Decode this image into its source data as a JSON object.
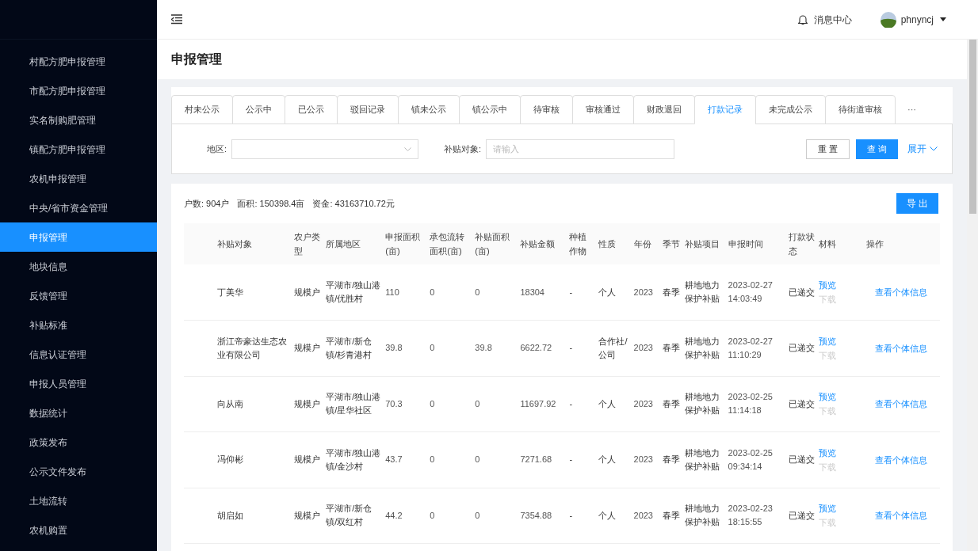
{
  "sidebar": {
    "items": [
      {
        "label": "村配方肥申报管理",
        "selected": false
      },
      {
        "label": "市配方肥申报管理",
        "selected": false
      },
      {
        "label": "实名制购肥管理",
        "selected": false
      },
      {
        "label": "镇配方肥申报管理",
        "selected": false
      },
      {
        "label": "农机申报管理",
        "selected": false
      },
      {
        "label": "中央/省市资金管理",
        "selected": false
      },
      {
        "label": "申报管理",
        "selected": true
      },
      {
        "label": "地块信息",
        "selected": false
      },
      {
        "label": "反馈管理",
        "selected": false
      },
      {
        "label": "补贴标准",
        "selected": false
      },
      {
        "label": "信息认证管理",
        "selected": false
      },
      {
        "label": "申报人员管理",
        "selected": false
      },
      {
        "label": "数据统计",
        "selected": false
      },
      {
        "label": "政策发布",
        "selected": false
      },
      {
        "label": "公示文件发布",
        "selected": false
      },
      {
        "label": "土地流转",
        "selected": false
      },
      {
        "label": "农机购置",
        "selected": false
      }
    ]
  },
  "header": {
    "messages": "消息中心",
    "user": "phnyncj"
  },
  "page_title": "申报管理",
  "tabs": [
    {
      "label": "村未公示",
      "selected": false
    },
    {
      "label": "公示中",
      "selected": false
    },
    {
      "label": "已公示",
      "selected": false
    },
    {
      "label": "驳回记录",
      "selected": false
    },
    {
      "label": "镇未公示",
      "selected": false
    },
    {
      "label": "镇公示中",
      "selected": false
    },
    {
      "label": "待审核",
      "selected": false
    },
    {
      "label": "审核通过",
      "selected": false
    },
    {
      "label": "财政退回",
      "selected": false
    },
    {
      "label": "打款记录",
      "selected": true
    },
    {
      "label": "未完成公示",
      "selected": false
    },
    {
      "label": "待街道审核",
      "selected": false
    }
  ],
  "tabs_more": "···",
  "filters": {
    "region_label": "地区:",
    "target_label": "补贴对象:",
    "target_placeholder": "请输入",
    "reset": "重 置",
    "search": "查 询",
    "expand": "展开"
  },
  "summary": {
    "households": "户数: 904户",
    "area": "面积: 150398.4亩",
    "funds": "资金: 43163710.72元",
    "export": "导 出"
  },
  "table": {
    "columns": [
      "补贴对象",
      "农户类型",
      "所属地区",
      "申报面积(亩)",
      "承包流转面积(亩)",
      "补贴面积(亩)",
      "补贴金额",
      "种植作物",
      "性质",
      "年份",
      "季节",
      "补贴项目",
      "申报时间",
      "打款状态",
      "材料",
      "操作"
    ],
    "rows": [
      {
        "cells": [
          "丁美华",
          "规模户",
          "平湖市/独山港镇/优胜村",
          "110",
          "0",
          "0",
          "18304",
          "-",
          "个人",
          "2023",
          "春季",
          "耕地地力保护补贴",
          "2023-02-27 14:03:49",
          "已递交"
        ],
        "preview": "预览",
        "download": {
          "label": "下载",
          "disabled": true
        },
        "action": "查看个体信息"
      },
      {
        "cells": [
          "浙江帝豪达生态农业有限公司",
          "规模户",
          "平湖市/新仓镇/杉青港村",
          "39.8",
          "0",
          "39.8",
          "6622.72",
          "-",
          "合作社/公司",
          "2023",
          "春季",
          "耕地地力保护补贴",
          "2023-02-27 11:10:29",
          "已递交"
        ],
        "preview": "预览",
        "download": {
          "label": "下载",
          "disabled": true
        },
        "action": "查看个体信息"
      },
      {
        "cells": [
          "向从南",
          "规模户",
          "平湖市/独山港镇/星华社区",
          "70.3",
          "0",
          "0",
          "11697.92",
          "-",
          "个人",
          "2023",
          "春季",
          "耕地地力保护补贴",
          "2023-02-25 11:14:18",
          "已递交"
        ],
        "preview": "预览",
        "download": {
          "label": "下载",
          "disabled": true
        },
        "action": "查看个体信息"
      },
      {
        "cells": [
          "冯仰彬",
          "规模户",
          "平湖市/独山港镇/金沙村",
          "43.7",
          "0",
          "0",
          "7271.68",
          "-",
          "个人",
          "2023",
          "春季",
          "耕地地力保护补贴",
          "2023-02-25 09:34:14",
          "已递交"
        ],
        "preview": "预览",
        "download": {
          "label": "下载",
          "disabled": true
        },
        "action": "查看个体信息"
      },
      {
        "cells": [
          "胡启如",
          "规模户",
          "平湖市/新仓镇/双红村",
          "44.2",
          "0",
          "0",
          "7354.88",
          "-",
          "个人",
          "2023",
          "春季",
          "耕地地力保护补贴",
          "2023-02-23 18:15:55",
          "已递交"
        ],
        "preview": "预览",
        "download": {
          "label": "下载",
          "disabled": true
        },
        "action": "查看个体信息"
      }
    ]
  }
}
